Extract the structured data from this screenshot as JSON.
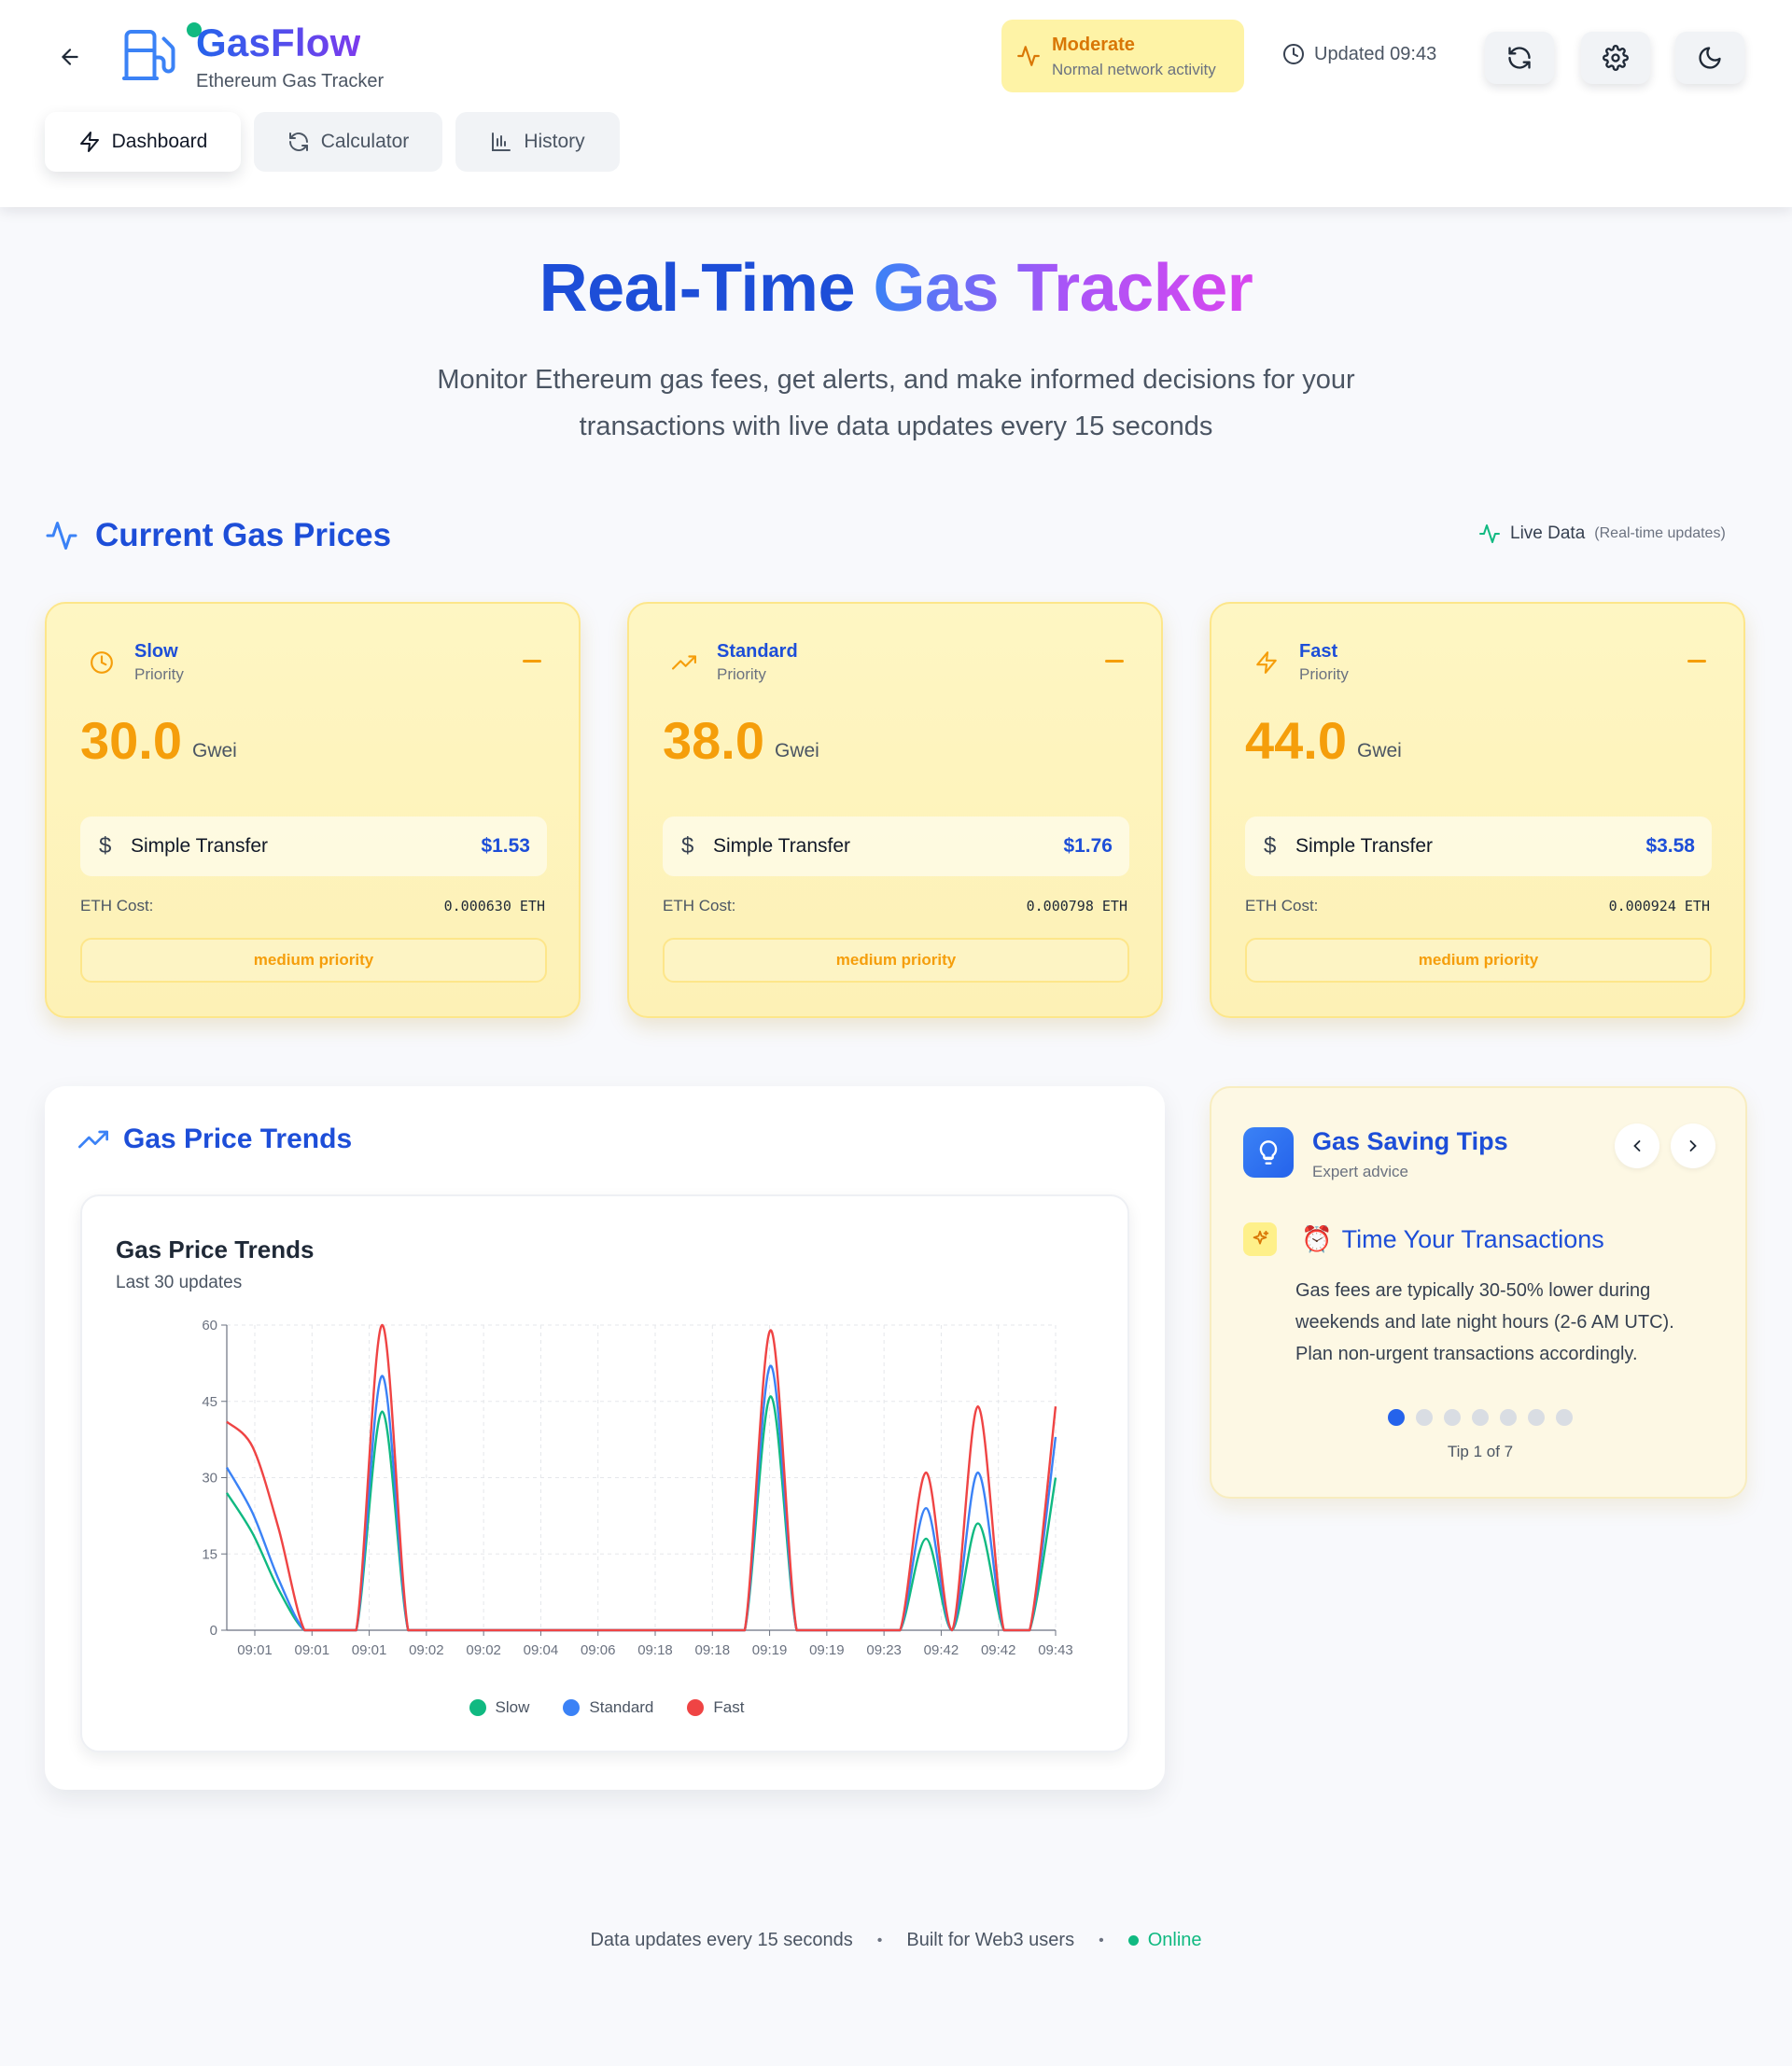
{
  "app": {
    "name": "GasFlow",
    "subtitle": "Ethereum Gas Tracker"
  },
  "status": {
    "level": "Moderate",
    "description": "Normal network activity",
    "updated": "Updated 09:43"
  },
  "header_buttons": {
    "refresh_icon": "refresh-icon",
    "settings_icon": "gear-icon",
    "theme_icon": "moon-icon"
  },
  "tabs": [
    {
      "label": "Dashboard",
      "icon": "lightning-icon",
      "active": true
    },
    {
      "label": "Calculator",
      "icon": "refresh-icon",
      "active": false
    },
    {
      "label": "History",
      "icon": "bar-chart-icon",
      "active": false
    }
  ],
  "hero": {
    "title_part1": "Real-Time",
    "title_part2": "Gas Tracker",
    "subtitle": "Monitor Ethereum gas fees, get alerts, and make informed decisions for your transactions with live data updates every 15 seconds"
  },
  "current_section": {
    "title": "Current Gas Prices",
    "live_label": "Live Data",
    "live_note": "(Real-time updates)"
  },
  "price_cards": [
    {
      "name": "Slow",
      "priority": "Priority",
      "value": "30.0",
      "unit": "Gwei",
      "transfer_label": "Simple Transfer",
      "transfer_cost": "$1.53",
      "eth_label": "ETH Cost:",
      "eth_value": "0.000630 ETH",
      "badge": "medium priority",
      "icon": "clock-icon"
    },
    {
      "name": "Standard",
      "priority": "Priority",
      "value": "38.0",
      "unit": "Gwei",
      "transfer_label": "Simple Transfer",
      "transfer_cost": "$1.76",
      "eth_label": "ETH Cost:",
      "eth_value": "0.000798 ETH",
      "badge": "medium priority",
      "icon": "trending-up-icon"
    },
    {
      "name": "Fast",
      "priority": "Priority",
      "value": "44.0",
      "unit": "Gwei",
      "transfer_label": "Simple Transfer",
      "transfer_cost": "$3.58",
      "eth_label": "ETH Cost:",
      "eth_value": "0.000924 ETH",
      "badge": "medium priority",
      "icon": "lightning-icon"
    }
  ],
  "trends": {
    "section_title": "Gas Price Trends",
    "chart_title": "Gas Price Trends",
    "chart_subtitle": "Last 30 updates"
  },
  "chart_data": {
    "type": "line",
    "title": "Gas Price Trends",
    "subtitle": "Last 30 updates",
    "xlabel": "",
    "ylabel": "",
    "ylim": [
      0,
      60
    ],
    "yticks": [
      0,
      15,
      30,
      45,
      60
    ],
    "x_tick_labels": [
      "09:01",
      "09:01",
      "09:01",
      "09:02",
      "09:02",
      "09:04",
      "09:06",
      "09:18",
      "09:18",
      "09:19",
      "09:19",
      "09:23",
      "09:42",
      "09:42",
      "09:43"
    ],
    "grid": true,
    "legend": "bottom",
    "series": [
      {
        "name": "Slow",
        "color": "#10b981",
        "values": [
          27,
          19,
          8,
          0,
          0,
          0,
          43,
          0,
          0,
          0,
          0,
          0,
          0,
          0,
          0,
          0,
          0,
          0,
          0,
          0,
          0,
          46,
          0,
          0,
          0,
          0,
          0,
          18,
          0,
          21,
          0,
          0,
          30
        ]
      },
      {
        "name": "Standard",
        "color": "#3b82f6",
        "values": [
          32,
          23,
          10,
          0,
          0,
          0,
          50,
          0,
          0,
          0,
          0,
          0,
          0,
          0,
          0,
          0,
          0,
          0,
          0,
          0,
          0,
          52,
          0,
          0,
          0,
          0,
          0,
          24,
          0,
          31,
          0,
          0,
          38
        ]
      },
      {
        "name": "Fast",
        "color": "#ef4444",
        "values": [
          41,
          36,
          20,
          0,
          0,
          0,
          60,
          0,
          0,
          0,
          0,
          0,
          0,
          0,
          0,
          0,
          0,
          0,
          0,
          0,
          0,
          59,
          0,
          0,
          0,
          0,
          0,
          31,
          0,
          44,
          0,
          0,
          44
        ]
      }
    ]
  },
  "tips": {
    "title": "Gas Saving Tips",
    "subtitle": "Expert advice",
    "tip_emoji": "⏰",
    "tip_title": "Time Your Transactions",
    "tip_body": "Gas fees are typically 30-50% lower during weekends and late night hours (2-6 AM UTC). Plan non-urgent transactions accordingly.",
    "counter": "Tip 1 of 7",
    "total": 7,
    "current": 1
  },
  "footer": {
    "updates": "Data updates every 15 seconds",
    "built": "Built for Web3 users",
    "online": "Online"
  },
  "colors": {
    "accent": "#1d4ed8",
    "warning": "#f59e0b",
    "success": "#10b981",
    "card_bg": "#fef3c7"
  }
}
